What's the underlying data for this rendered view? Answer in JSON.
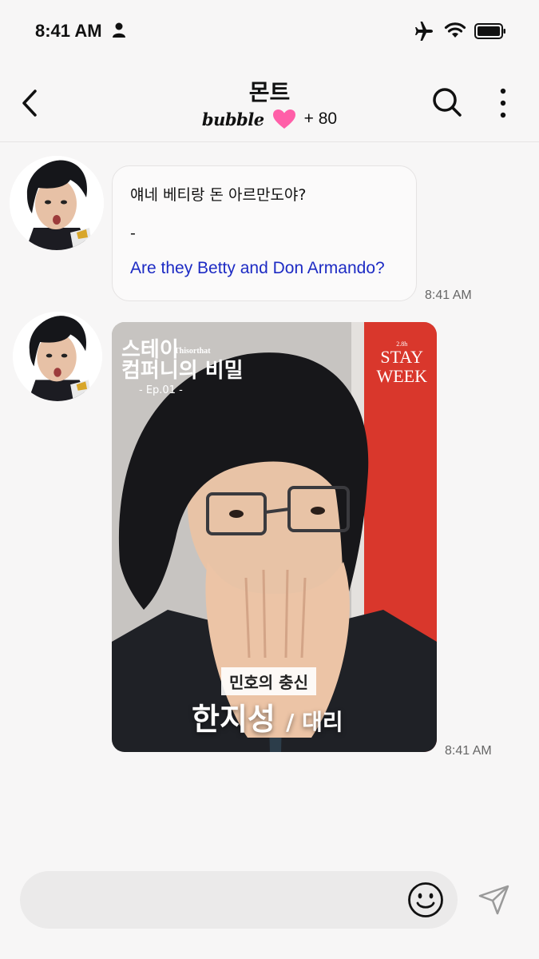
{
  "status_bar": {
    "time": "8:41 AM",
    "icons": [
      "person-icon",
      "airplane-icon",
      "wifi-icon",
      "battery-icon"
    ]
  },
  "header": {
    "title": "몬트",
    "brand": "bubble",
    "count": "+ 80",
    "icons": [
      "back-arrow-icon",
      "heart-icon",
      "search-icon",
      "more-vertical-icon"
    ],
    "heart_color": "#ff5fa8"
  },
  "messages": [
    {
      "type": "text",
      "korean": "얘네 베티랑 돈 아르만도야?",
      "separator": "-",
      "translation": "Are they Betty and Don Armando?",
      "time": "8:41 AM"
    },
    {
      "type": "image",
      "show_title_line1": "스테이",
      "show_title_line2": "컴퍼니의 비밀",
      "show_brand": "Thisorthat",
      "episode": "- Ep.01 -",
      "stay_small": "2.8h",
      "stay_line1": "STAY",
      "stay_line2": "WEEK",
      "caption": "민호의 충신",
      "name": "한지성",
      "role": "/ 대리",
      "time": "8:41 AM"
    }
  ],
  "composer": {
    "placeholder": "",
    "icons": [
      "smiley-icon",
      "send-icon"
    ]
  },
  "colors": {
    "background": "#f7f6f6",
    "translation_text": "#1d2bc4",
    "card_red": "#d9372c"
  }
}
